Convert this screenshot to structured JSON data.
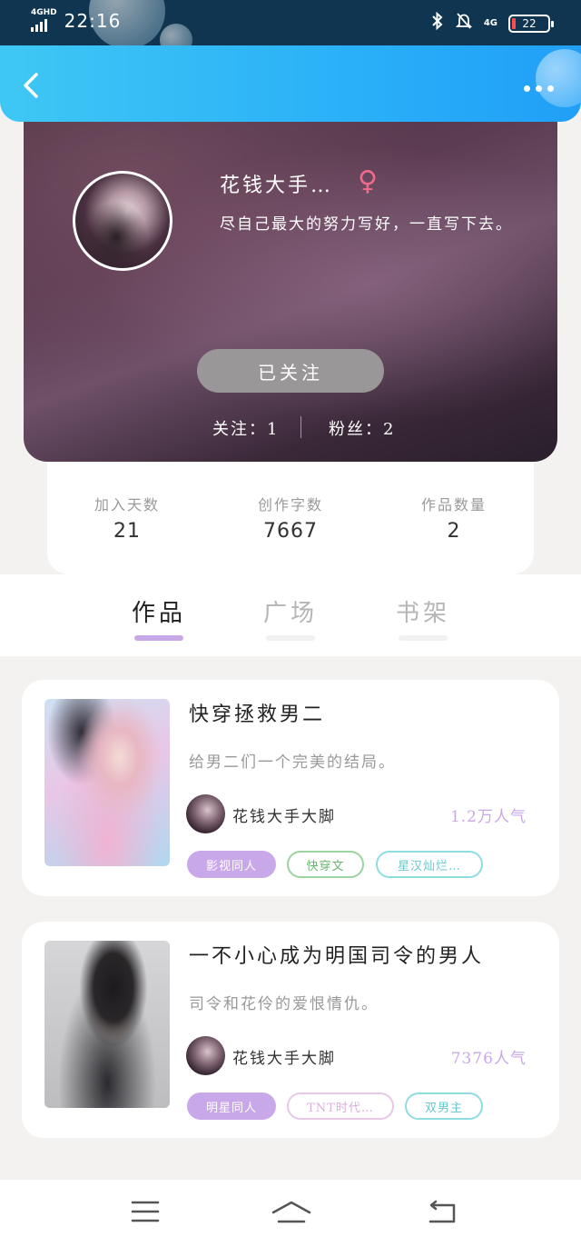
{
  "status_bar": {
    "network_type": "4GHD",
    "time": "22:16",
    "mobile_data": "4G",
    "battery_level": "22"
  },
  "header": {
    "back_icon": "chevron-left-icon",
    "more_icon": "more-dots-icon"
  },
  "profile": {
    "name": "花钱大手…",
    "gender_icon": "female-icon",
    "gender_symbol": "♀",
    "bio": "尽自己最大的努力写好，一直写下去。",
    "follow_button": "已关注",
    "following": "关注：1",
    "fans": "粉丝：2"
  },
  "stats": [
    {
      "label": "加入天数",
      "value": "21"
    },
    {
      "label": "创作字数",
      "value": "7667"
    },
    {
      "label": "作品数量",
      "value": "2"
    }
  ],
  "tabs": [
    {
      "label": "作品",
      "active": true
    },
    {
      "label": "广场",
      "active": false
    },
    {
      "label": "书架",
      "active": false
    }
  ],
  "books": [
    {
      "title": "快穿拯救男二",
      "description": "给男二们一个完美的结局。",
      "author": "花钱大手大脚",
      "popularity": "1.2万人气",
      "tags": [
        "影视同人",
        "快穿文",
        "星汉灿烂…"
      ]
    },
    {
      "title": "一不小心成为明国司令的男人",
      "description": "司令和花伶的爱恨情仇。",
      "author": "花钱大手大脚",
      "popularity": "7376人气",
      "tags": [
        "明星同人",
        "TNT时代…",
        "双男主"
      ]
    }
  ],
  "nav_bar": {
    "menu_icon": "menu-icon",
    "home_icon": "home-icon",
    "back_icon": "back-arrow-icon"
  },
  "colors": {
    "accent": "#c9a8ea",
    "header_blue": "#2ab0f8",
    "gender_pink": "#f06a8a"
  }
}
